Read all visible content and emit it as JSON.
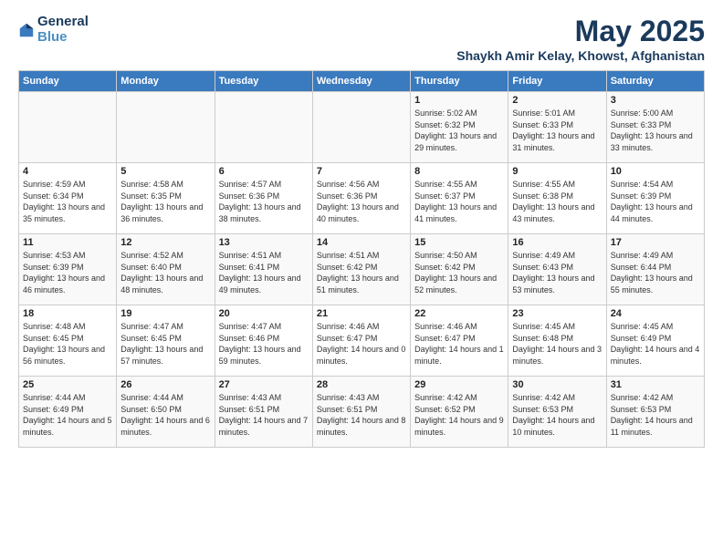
{
  "header": {
    "logo_general": "General",
    "logo_blue": "Blue",
    "title": "May 2025",
    "location": "Shaykh Amir Kelay, Khowst, Afghanistan"
  },
  "weekdays": [
    "Sunday",
    "Monday",
    "Tuesday",
    "Wednesday",
    "Thursday",
    "Friday",
    "Saturday"
  ],
  "weeks": [
    [
      {
        "day": "",
        "info": ""
      },
      {
        "day": "",
        "info": ""
      },
      {
        "day": "",
        "info": ""
      },
      {
        "day": "",
        "info": ""
      },
      {
        "day": "1",
        "info": "Sunrise: 5:02 AM\nSunset: 6:32 PM\nDaylight: 13 hours\nand 29 minutes."
      },
      {
        "day": "2",
        "info": "Sunrise: 5:01 AM\nSunset: 6:33 PM\nDaylight: 13 hours\nand 31 minutes."
      },
      {
        "day": "3",
        "info": "Sunrise: 5:00 AM\nSunset: 6:33 PM\nDaylight: 13 hours\nand 33 minutes."
      }
    ],
    [
      {
        "day": "4",
        "info": "Sunrise: 4:59 AM\nSunset: 6:34 PM\nDaylight: 13 hours\nand 35 minutes."
      },
      {
        "day": "5",
        "info": "Sunrise: 4:58 AM\nSunset: 6:35 PM\nDaylight: 13 hours\nand 36 minutes."
      },
      {
        "day": "6",
        "info": "Sunrise: 4:57 AM\nSunset: 6:36 PM\nDaylight: 13 hours\nand 38 minutes."
      },
      {
        "day": "7",
        "info": "Sunrise: 4:56 AM\nSunset: 6:36 PM\nDaylight: 13 hours\nand 40 minutes."
      },
      {
        "day": "8",
        "info": "Sunrise: 4:55 AM\nSunset: 6:37 PM\nDaylight: 13 hours\nand 41 minutes."
      },
      {
        "day": "9",
        "info": "Sunrise: 4:55 AM\nSunset: 6:38 PM\nDaylight: 13 hours\nand 43 minutes."
      },
      {
        "day": "10",
        "info": "Sunrise: 4:54 AM\nSunset: 6:39 PM\nDaylight: 13 hours\nand 44 minutes."
      }
    ],
    [
      {
        "day": "11",
        "info": "Sunrise: 4:53 AM\nSunset: 6:39 PM\nDaylight: 13 hours\nand 46 minutes."
      },
      {
        "day": "12",
        "info": "Sunrise: 4:52 AM\nSunset: 6:40 PM\nDaylight: 13 hours\nand 48 minutes."
      },
      {
        "day": "13",
        "info": "Sunrise: 4:51 AM\nSunset: 6:41 PM\nDaylight: 13 hours\nand 49 minutes."
      },
      {
        "day": "14",
        "info": "Sunrise: 4:51 AM\nSunset: 6:42 PM\nDaylight: 13 hours\nand 51 minutes."
      },
      {
        "day": "15",
        "info": "Sunrise: 4:50 AM\nSunset: 6:42 PM\nDaylight: 13 hours\nand 52 minutes."
      },
      {
        "day": "16",
        "info": "Sunrise: 4:49 AM\nSunset: 6:43 PM\nDaylight: 13 hours\nand 53 minutes."
      },
      {
        "day": "17",
        "info": "Sunrise: 4:49 AM\nSunset: 6:44 PM\nDaylight: 13 hours\nand 55 minutes."
      }
    ],
    [
      {
        "day": "18",
        "info": "Sunrise: 4:48 AM\nSunset: 6:45 PM\nDaylight: 13 hours\nand 56 minutes."
      },
      {
        "day": "19",
        "info": "Sunrise: 4:47 AM\nSunset: 6:45 PM\nDaylight: 13 hours\nand 57 minutes."
      },
      {
        "day": "20",
        "info": "Sunrise: 4:47 AM\nSunset: 6:46 PM\nDaylight: 13 hours\nand 59 minutes."
      },
      {
        "day": "21",
        "info": "Sunrise: 4:46 AM\nSunset: 6:47 PM\nDaylight: 14 hours\nand 0 minutes."
      },
      {
        "day": "22",
        "info": "Sunrise: 4:46 AM\nSunset: 6:47 PM\nDaylight: 14 hours\nand 1 minute."
      },
      {
        "day": "23",
        "info": "Sunrise: 4:45 AM\nSunset: 6:48 PM\nDaylight: 14 hours\nand 3 minutes."
      },
      {
        "day": "24",
        "info": "Sunrise: 4:45 AM\nSunset: 6:49 PM\nDaylight: 14 hours\nand 4 minutes."
      }
    ],
    [
      {
        "day": "25",
        "info": "Sunrise: 4:44 AM\nSunset: 6:49 PM\nDaylight: 14 hours\nand 5 minutes."
      },
      {
        "day": "26",
        "info": "Sunrise: 4:44 AM\nSunset: 6:50 PM\nDaylight: 14 hours\nand 6 minutes."
      },
      {
        "day": "27",
        "info": "Sunrise: 4:43 AM\nSunset: 6:51 PM\nDaylight: 14 hours\nand 7 minutes."
      },
      {
        "day": "28",
        "info": "Sunrise: 4:43 AM\nSunset: 6:51 PM\nDaylight: 14 hours\nand 8 minutes."
      },
      {
        "day": "29",
        "info": "Sunrise: 4:42 AM\nSunset: 6:52 PM\nDaylight: 14 hours\nand 9 minutes."
      },
      {
        "day": "30",
        "info": "Sunrise: 4:42 AM\nSunset: 6:53 PM\nDaylight: 14 hours\nand 10 minutes."
      },
      {
        "day": "31",
        "info": "Sunrise: 4:42 AM\nSunset: 6:53 PM\nDaylight: 14 hours\nand 11 minutes."
      }
    ]
  ]
}
